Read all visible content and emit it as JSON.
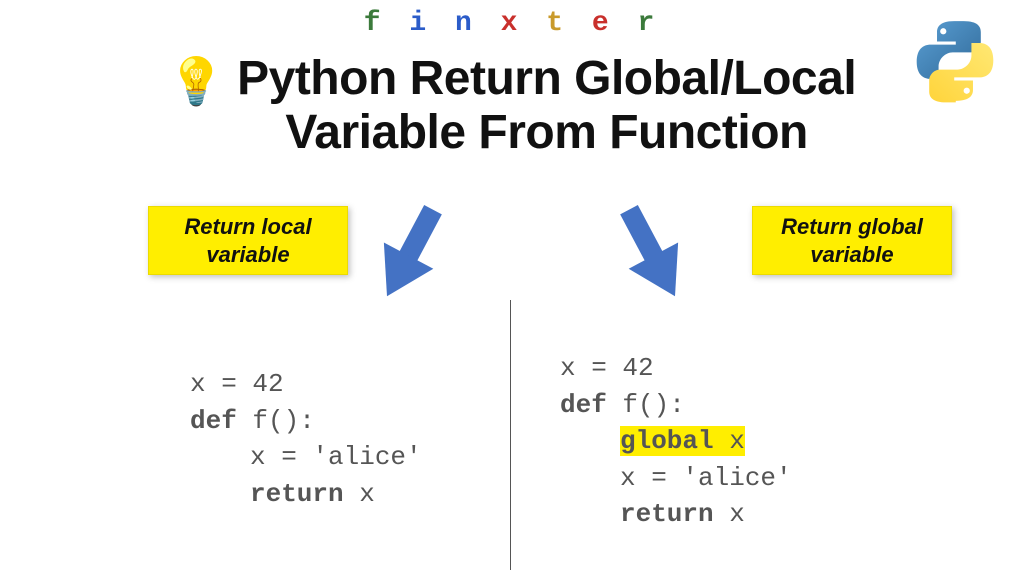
{
  "brand": {
    "letters": [
      "f",
      "i",
      "n",
      "x",
      "t",
      "e",
      "r"
    ],
    "colors": [
      "#3b7a3b",
      "#2b5cc9",
      "#2b5cc9",
      "#c9302c",
      "#c99a2b",
      "#c9302c",
      "#3b7a3b"
    ]
  },
  "title": {
    "line1": "Python Return Global/Local",
    "line2": "Variable From Function"
  },
  "labels": {
    "left": {
      "line1": "Return local",
      "line2": "variable"
    },
    "right": {
      "line1": "Return global",
      "line2": "variable"
    }
  },
  "code": {
    "left": {
      "l1_pre": "x = 42",
      "l2_kw": "def",
      "l2_rest": " f():",
      "l3_indent": "x = 'alice'",
      "l4_kw": "return",
      "l4_rest": " x"
    },
    "right": {
      "l1_pre": "x = 42",
      "l2_kw": "def",
      "l2_rest": " f():",
      "l3_kw_hl": "global",
      "l3_rest_hl": " x",
      "l4_indent": "x = 'alice'",
      "l5_kw": "return",
      "l5_rest": " x"
    }
  },
  "colors": {
    "highlight": "#ffee00",
    "arrow": "#4472c4"
  }
}
